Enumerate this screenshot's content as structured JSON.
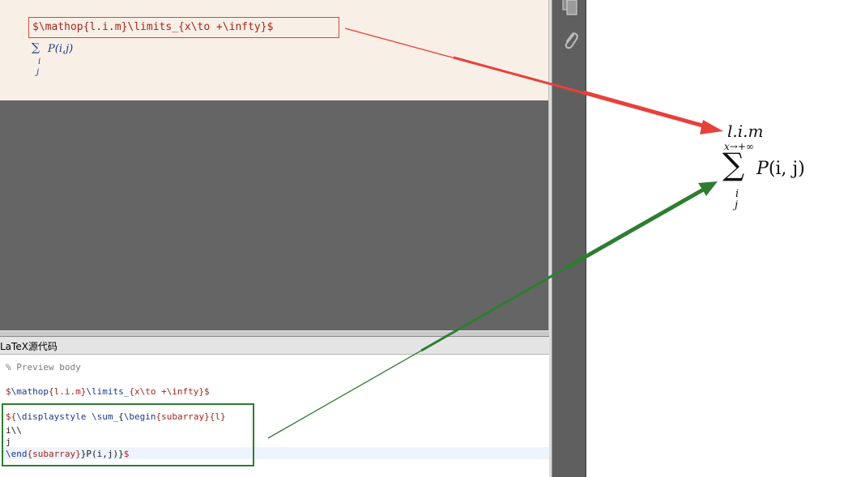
{
  "editor": {
    "latex_source": "$\\mathop{l.i.m}\\limits_{x\\to +\\infty}$",
    "preview_sum": {
      "sigma": "∑",
      "term": "P(i,j)",
      "index_i": "i",
      "index_j": "j"
    }
  },
  "rendered": {
    "operator": "l.i.m",
    "underscript": "x→+∞",
    "sigma": "∑",
    "term_P": "P",
    "term_args": "(i, j)",
    "index_i": "i",
    "index_j": "j"
  },
  "source_panel": {
    "title": "LaTeX源代码",
    "lines": {
      "comment": "% Preview body",
      "l2_dollar_open": "$",
      "l2_cmd": "\\mathop",
      "l2_arg": "{l.i.m}",
      "l2_cmd2": "\\limits_",
      "l2_arg2": "{x\\to +\\infty}",
      "l2_dollar_close": "$",
      "l3_a": "${",
      "l3_cmd": "\\displaystyle \\sum_",
      "l3_b": "{",
      "l3_cmd2": "\\begin",
      "l3_arg": "{subarray}{l}",
      "l4": "i\\\\",
      "l5": "j",
      "l6_cmd": "\\end",
      "l6_arg": "{subarray}",
      "l6_rest": "}P(i,j)}",
      "l6_dollar": "$"
    }
  },
  "toolbar": {
    "icons": [
      "copy-pages-icon",
      "attachment-icon"
    ]
  },
  "colors": {
    "red_arrow": "#e8403a",
    "green_arrow": "#2e7d32",
    "editor_bg": "#f8efe6",
    "workspace_bg": "#656565"
  }
}
